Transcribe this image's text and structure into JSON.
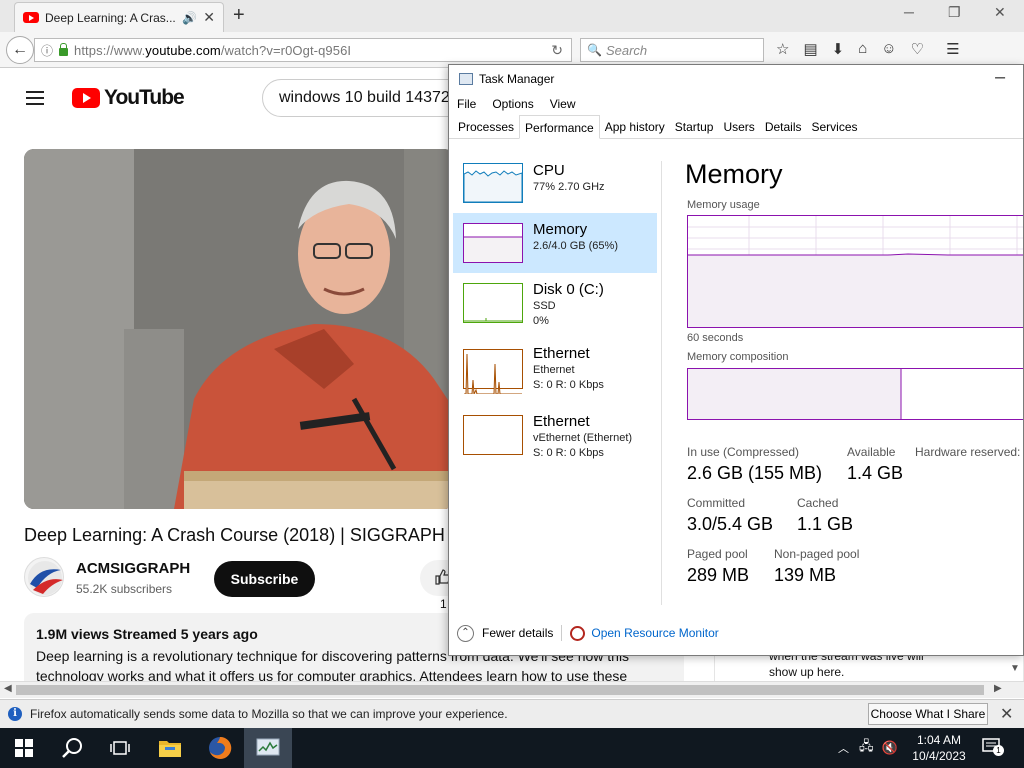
{
  "browser": {
    "tab_title": "Deep Learning: A Cras...",
    "url_prefix": "https://www.",
    "url_domain": "youtube.com",
    "url_path": "/watch?v=r0Ogt-q956I",
    "search_placeholder": "Search"
  },
  "youtube": {
    "logo_text": "YouTube",
    "search_query": "windows 10 build 14372",
    "video_title": "Deep Learning: A Crash Course (2018) | SIGGRAPH",
    "channel_name": "ACMSIGGRAPH",
    "channel_subs": "55.2K subscribers",
    "subscribe_label": "Subscribe",
    "like_count": "1",
    "views_meta": "1.9M views  Streamed 5 years ago",
    "description_line1": "Deep learning is a revolutionary technique for discovering patterns from data. We'll see how this",
    "description_line2": "technology works and what it offers us for computer graphics. Attendees learn how to use these",
    "chat_text_line1": "when the stream was live will",
    "chat_text_line2": "show up here."
  },
  "notification": {
    "message": "Firefox automatically sends some data to Mozilla so that we can improve your experience.",
    "button": "Choose What I Share"
  },
  "task_manager": {
    "title": "Task Manager",
    "menu": [
      "File",
      "Options",
      "View"
    ],
    "tabs": [
      "Processes",
      "Performance",
      "App history",
      "Startup",
      "Users",
      "Details",
      "Services"
    ],
    "active_tab": "Performance",
    "resources": [
      {
        "name": "CPU",
        "sub1": "77%  2.70 GHz",
        "sub2": ""
      },
      {
        "name": "Memory",
        "sub1": "2.6/4.0 GB (65%)",
        "sub2": ""
      },
      {
        "name": "Disk 0 (C:)",
        "sub1": "SSD",
        "sub2": "0%"
      },
      {
        "name": "Ethernet",
        "sub1": "Ethernet",
        "sub2": "S: 0 R: 0 Kbps"
      },
      {
        "name": "Ethernet",
        "sub1": "vEthernet (Ethernet)",
        "sub2": "S: 0 R: 0 Kbps"
      }
    ],
    "memory": {
      "heading": "Memory",
      "usage_label": "Memory usage",
      "time_label": "60 seconds",
      "composition_label": "Memory composition",
      "in_use_label": "In use (Compressed)",
      "in_use_value": "2.6 GB (155 MB)",
      "available_label": "Available",
      "available_value": "1.4 GB",
      "hw_reserved_label": "Hardware reserved:",
      "committed_label": "Committed",
      "committed_value": "3.0/5.4 GB",
      "cached_label": "Cached",
      "cached_value": "1.1 GB",
      "paged_label": "Paged pool",
      "paged_value": "289 MB",
      "nonpaged_label": "Non-paged pool",
      "nonpaged_value": "139 MB",
      "in_use_fraction": 0.65
    },
    "footer": {
      "fewer_details": "Fewer details",
      "open_resource_monitor": "Open Resource Monitor"
    }
  },
  "taskbar": {
    "time": "1:04 AM",
    "date": "10/4/2023",
    "notification_count": "1"
  },
  "colors": {
    "memory": "#8b12ae",
    "cpu": "#117dbb",
    "disk": "#4da60c",
    "ethernet": "#a74f01",
    "youtube_red": "#ff0000"
  }
}
